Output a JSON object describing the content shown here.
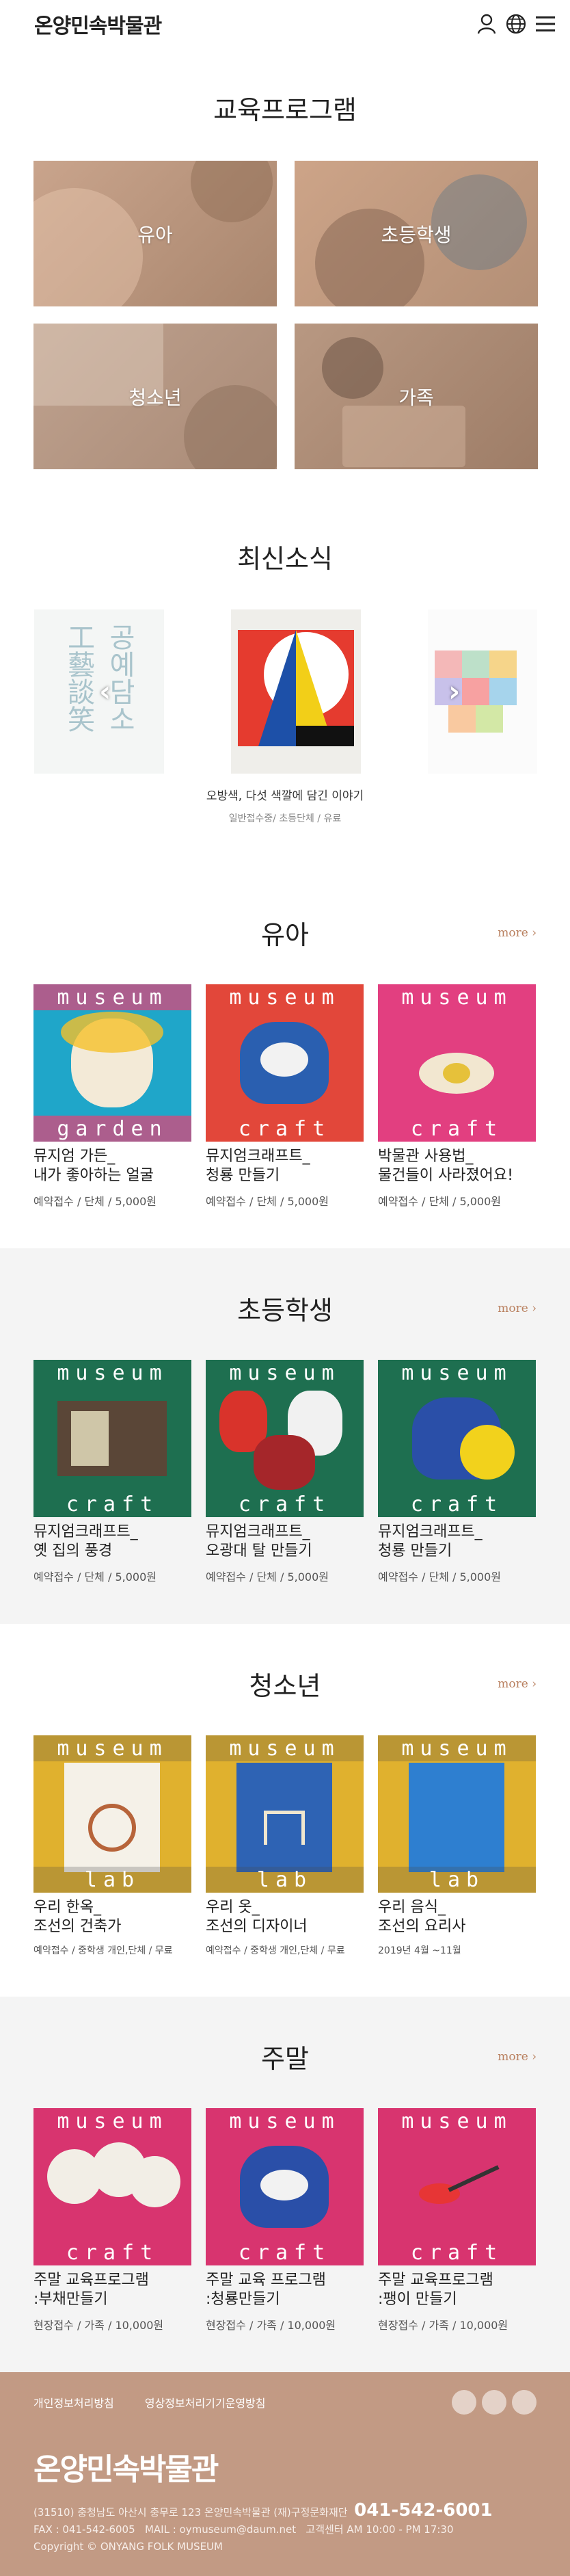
{
  "header": {
    "logo": "온양민속박물관"
  },
  "programs": {
    "title": "교육프로그램",
    "tiles": [
      {
        "label": "유아"
      },
      {
        "label": "초등학생"
      },
      {
        "label": "청소년"
      },
      {
        "label": "가족"
      }
    ]
  },
  "news": {
    "title": "최신소식",
    "caption": "오방색, 다섯 색깔에 담긴 이야기",
    "sub": "일반접수중/ 초등단체 / 유료",
    "left_poster_text": "공예담소 工藝談笑"
  },
  "sections": [
    {
      "title": "유아",
      "more": "more",
      "cards": [
        {
          "band_top": "museum",
          "band_bottom": "garden",
          "title1": "뮤지엄 가든_",
          "title2": "내가 좋아하는 얼굴",
          "meta": "예약접수 / 단체 / 5,000원"
        },
        {
          "band_top": "museum",
          "band_bottom": "craft",
          "title1": "뮤지엄크래프트_",
          "title2": "청룡 만들기",
          "meta": "예약접수 / 단체 / 5,000원"
        },
        {
          "band_top": "museum",
          "band_bottom": "craft",
          "title1": "박물관 사용법_",
          "title2": "물건들이 사라졌어요!",
          "meta": "예약접수 / 단체 / 5,000원"
        }
      ]
    },
    {
      "title": "초등학생",
      "more": "more",
      "cards": [
        {
          "band_top": "museum",
          "band_bottom": "craft",
          "title1": "뮤지엄크래프트_",
          "title2": "옛 집의 풍경",
          "meta": "예약접수 / 단체 / 5,000원"
        },
        {
          "band_top": "museum",
          "band_bottom": "craft",
          "title1": "뮤지엄크래프트_",
          "title2": "오광대 탈 만들기",
          "meta": "예약접수 / 단체 / 5,000원"
        },
        {
          "band_top": "museum",
          "band_bottom": "craft",
          "title1": "뮤지엄크래프트_",
          "title2": "청룡 만들기",
          "meta": "예약접수 / 단체 / 5,000원"
        }
      ]
    },
    {
      "title": "청소년",
      "more": "more",
      "cards": [
        {
          "band_top": "museum",
          "band_bottom": "lab",
          "title1": "우리 한옥_",
          "title2": "조선의 건축가",
          "meta": "예약접수 / 중학생 개인,단체 / 무료"
        },
        {
          "band_top": "museum",
          "band_bottom": "lab",
          "title1": "우리 옷_",
          "title2": "조선의 디자이너",
          "meta": "예약접수 / 중학생 개인,단체 / 무료"
        },
        {
          "band_top": "museum",
          "band_bottom": "lab",
          "title1": "우리 음식_",
          "title2": "조선의 요리사",
          "meta": "2019년 4월 ~11월"
        }
      ]
    },
    {
      "title": "주말",
      "more": "more",
      "cards": [
        {
          "band_top": "museum",
          "band_bottom": "craft",
          "title1": "주말 교육프로그램",
          "title2": ":부채만들기",
          "meta": "현장접수 / 가족 / 10,000원"
        },
        {
          "band_top": "museum",
          "band_bottom": "craft",
          "title1": "주말 교육 프로그램",
          "title2": ":청룡만들기",
          "meta": "현장접수 / 가족 / 10,000원"
        },
        {
          "band_top": "museum",
          "band_bottom": "craft",
          "title1": "주말 교육프로그램",
          "title2": ":팽이 만들기",
          "meta": "현장접수 / 가족 / 10,000원"
        }
      ]
    }
  ],
  "footer": {
    "link1": "개인정보처리방침",
    "link2": "영상정보처리기기운영방침",
    "logo": "온양민속박물관",
    "address": "(31510) 충청남도 아산시 충무로 123 온양민속박물관 (재)구정문화재단",
    "phone": "041-542-6001",
    "fax": "FAX : 041-542-6005",
    "mail": "MAIL : oymuseum@daum.net",
    "hours": "고객센터 AM 10:00 - PM 17:30",
    "copyright": "Copyright © ONYANG FOLK MUSEUM"
  }
}
